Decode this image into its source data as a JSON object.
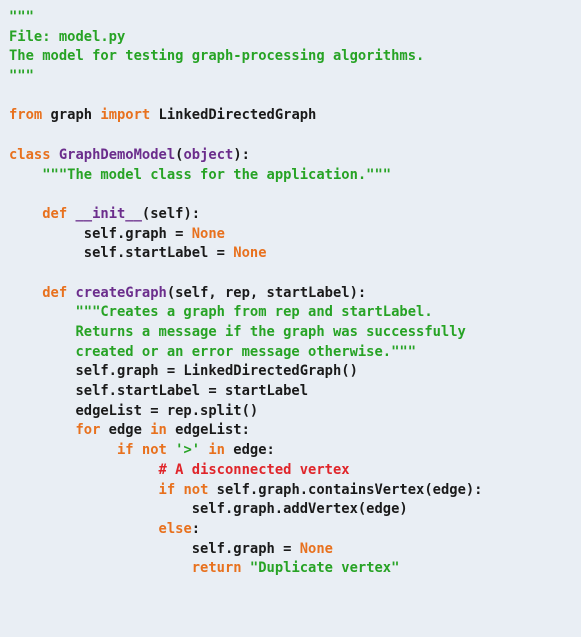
{
  "colors": {
    "background": "#e9eef4",
    "keyword": "#e8711e",
    "string": "#27a325",
    "name": "#6b2d8c",
    "comment": "#e0252a",
    "text": "#1a1a1a"
  },
  "code": {
    "lines": [
      [
        {
          "t": "\"\"\"",
          "c": "str"
        }
      ],
      [
        {
          "t": "File: model.py",
          "c": "str"
        }
      ],
      [
        {
          "t": "The model for testing graph-processing algorithms.",
          "c": "str"
        }
      ],
      [
        {
          "t": "\"\"\"",
          "c": "str"
        }
      ],
      [],
      [
        {
          "t": "from",
          "c": "kw"
        },
        {
          "t": " graph ",
          "c": "plain"
        },
        {
          "t": "import",
          "c": "kw"
        },
        {
          "t": " LinkedDirectedGraph",
          "c": "plain"
        }
      ],
      [],
      [
        {
          "t": "class",
          "c": "kw"
        },
        {
          "t": " ",
          "c": "plain"
        },
        {
          "t": "GraphDemoModel",
          "c": "fn"
        },
        {
          "t": "(",
          "c": "plain"
        },
        {
          "t": "object",
          "c": "fn"
        },
        {
          "t": "):",
          "c": "plain"
        }
      ],
      [
        {
          "t": "    ",
          "c": "plain"
        },
        {
          "t": "\"\"\"The model class for the application.\"\"\"",
          "c": "str"
        }
      ],
      [],
      [
        {
          "t": "    ",
          "c": "plain"
        },
        {
          "t": "def",
          "c": "kw"
        },
        {
          "t": " ",
          "c": "plain"
        },
        {
          "t": "__init__",
          "c": "fn"
        },
        {
          "t": "(self):",
          "c": "plain"
        }
      ],
      [
        {
          "t": "         self.graph = ",
          "c": "plain"
        },
        {
          "t": "None",
          "c": "kw"
        }
      ],
      [
        {
          "t": "         self.startLabel = ",
          "c": "plain"
        },
        {
          "t": "None",
          "c": "kw"
        }
      ],
      [],
      [
        {
          "t": "    ",
          "c": "plain"
        },
        {
          "t": "def",
          "c": "kw"
        },
        {
          "t": " ",
          "c": "plain"
        },
        {
          "t": "createGraph",
          "c": "fn"
        },
        {
          "t": "(self, rep, startLabel):",
          "c": "plain"
        }
      ],
      [
        {
          "t": "        ",
          "c": "plain"
        },
        {
          "t": "\"\"\"Creates a graph from rep and startLabel.",
          "c": "str"
        }
      ],
      [
        {
          "t": "        ",
          "c": "plain"
        },
        {
          "t": "Returns a message if the graph was successfully",
          "c": "str"
        }
      ],
      [
        {
          "t": "        ",
          "c": "plain"
        },
        {
          "t": "created or an error message otherwise.\"\"\"",
          "c": "str"
        }
      ],
      [
        {
          "t": "        self.graph = LinkedDirectedGraph()",
          "c": "plain"
        }
      ],
      [
        {
          "t": "        self.startLabel = startLabel",
          "c": "plain"
        }
      ],
      [
        {
          "t": "        edgeList = rep.split()",
          "c": "plain"
        }
      ],
      [
        {
          "t": "        ",
          "c": "plain"
        },
        {
          "t": "for",
          "c": "kw"
        },
        {
          "t": " edge ",
          "c": "plain"
        },
        {
          "t": "in",
          "c": "kw"
        },
        {
          "t": " edgeList:",
          "c": "plain"
        }
      ],
      [
        {
          "t": "             ",
          "c": "plain"
        },
        {
          "t": "if not",
          "c": "kw"
        },
        {
          "t": " ",
          "c": "plain"
        },
        {
          "t": "'>'",
          "c": "str"
        },
        {
          "t": " ",
          "c": "plain"
        },
        {
          "t": "in",
          "c": "kw"
        },
        {
          "t": " edge:",
          "c": "plain"
        }
      ],
      [
        {
          "t": "                  ",
          "c": "plain"
        },
        {
          "t": "# A disconnected vertex",
          "c": "cm"
        }
      ],
      [
        {
          "t": "                  ",
          "c": "plain"
        },
        {
          "t": "if not",
          "c": "kw"
        },
        {
          "t": " self.graph.containsVertex(edge):",
          "c": "plain"
        }
      ],
      [
        {
          "t": "                      self.graph.addVertex(edge)",
          "c": "plain"
        }
      ],
      [
        {
          "t": "                  ",
          "c": "plain"
        },
        {
          "t": "else",
          "c": "kw"
        },
        {
          "t": ":",
          "c": "plain"
        }
      ],
      [
        {
          "t": "                      self.graph = ",
          "c": "plain"
        },
        {
          "t": "None",
          "c": "kw"
        }
      ],
      [
        {
          "t": "                      ",
          "c": "plain"
        },
        {
          "t": "return",
          "c": "kw"
        },
        {
          "t": " ",
          "c": "plain"
        },
        {
          "t": "\"Duplicate vertex\"",
          "c": "str"
        }
      ]
    ]
  }
}
